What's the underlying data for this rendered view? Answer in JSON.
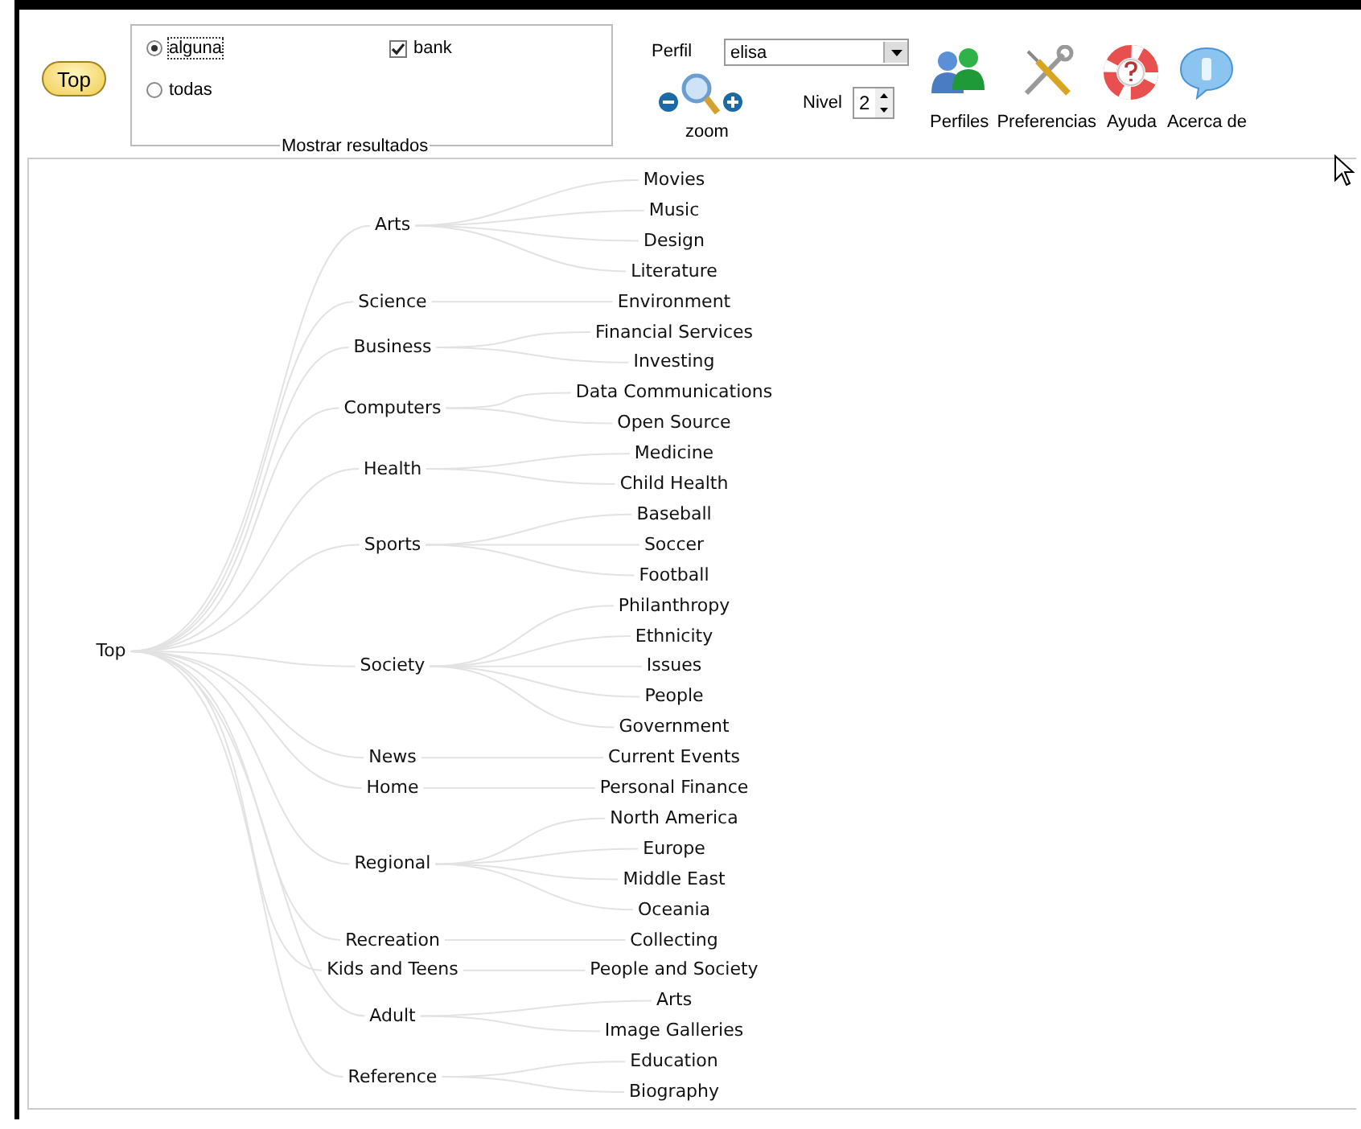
{
  "toolbar": {
    "top_button": "Top",
    "results": {
      "legend": "Mostrar resultados",
      "options": [
        {
          "label": "alguna",
          "selected": true
        },
        {
          "label": "todas",
          "selected": false
        }
      ],
      "filter": {
        "label": "bank",
        "checked": true
      }
    },
    "profile": {
      "label": "Perfil",
      "value": "elisa"
    },
    "zoom": {
      "label": "zoom"
    },
    "level": {
      "label": "Nivel",
      "value": "2"
    },
    "actions": [
      {
        "kind": "profiles",
        "label": "Perfiles"
      },
      {
        "kind": "preferences",
        "label": "Preferencias"
      },
      {
        "kind": "help",
        "label": "Ayuda"
      },
      {
        "kind": "about",
        "label": "Acerca de"
      }
    ]
  },
  "tree": {
    "root": {
      "label": "Top",
      "children": [
        {
          "label": "Arts",
          "children": [
            {
              "label": "Movies"
            },
            {
              "label": "Music"
            },
            {
              "label": "Design"
            },
            {
              "label": "Literature"
            }
          ]
        },
        {
          "label": "Science",
          "children": [
            {
              "label": "Environment"
            }
          ]
        },
        {
          "label": "Business",
          "children": [
            {
              "label": "Financial Services"
            },
            {
              "label": "Investing"
            }
          ]
        },
        {
          "label": "Computers",
          "children": [
            {
              "label": "Data Communications"
            },
            {
              "label": "Open Source"
            }
          ]
        },
        {
          "label": "Health",
          "children": [
            {
              "label": "Medicine"
            },
            {
              "label": "Child Health"
            }
          ]
        },
        {
          "label": "Sports",
          "children": [
            {
              "label": "Baseball"
            },
            {
              "label": "Soccer"
            },
            {
              "label": "Football"
            }
          ]
        },
        {
          "label": "Society",
          "children": [
            {
              "label": "Philanthropy"
            },
            {
              "label": "Ethnicity"
            },
            {
              "label": "Issues"
            },
            {
              "label": "People"
            },
            {
              "label": "Government"
            }
          ]
        },
        {
          "label": "News",
          "children": [
            {
              "label": "Current Events"
            }
          ]
        },
        {
          "label": "Home",
          "children": [
            {
              "label": "Personal Finance"
            }
          ]
        },
        {
          "label": "Regional",
          "children": [
            {
              "label": "North America"
            },
            {
              "label": "Europe"
            },
            {
              "label": "Middle East"
            },
            {
              "label": "Oceania"
            }
          ]
        },
        {
          "label": "Recreation",
          "children": [
            {
              "label": "Collecting"
            }
          ]
        },
        {
          "label": "Kids and Teens",
          "children": [
            {
              "label": "People and Society"
            }
          ]
        },
        {
          "label": "Adult",
          "children": [
            {
              "label": "Arts"
            },
            {
              "label": "Image Galleries"
            }
          ]
        },
        {
          "label": "Reference",
          "children": [
            {
              "label": "Education"
            },
            {
              "label": "Biography"
            }
          ]
        }
      ]
    }
  }
}
